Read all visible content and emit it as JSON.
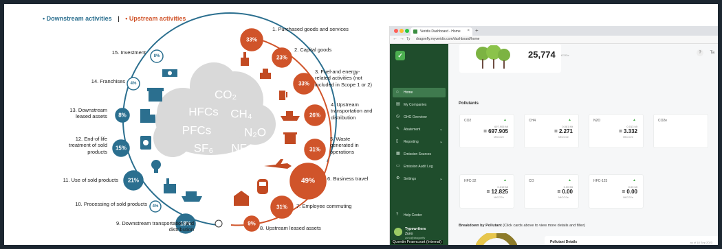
{
  "legend": {
    "downstream": "• Downstream activities",
    "separator": "|",
    "upstream": "• Upstream activities"
  },
  "colors": {
    "downstream": "#2b6f8f",
    "upstream": "#d0542a",
    "cloud": "#d9d9d9",
    "sidebar": "#1f4d2c",
    "accent_green": "#4caf50"
  },
  "cloud_gases": [
    "CO2",
    "HFCs",
    "CH4",
    "PFCs",
    "N2O",
    "SF6",
    "NF3"
  ],
  "categories": [
    {
      "label": "1. Purchased goods and services",
      "pct": "33%",
      "stream": "upstream"
    },
    {
      "label": "2. Capital goods",
      "pct": "23%",
      "stream": "upstream"
    },
    {
      "label": "3. Fuel-and energy-related activities (not included in Scope 1 or 2)",
      "pct": "33%",
      "stream": "upstream"
    },
    {
      "label": "4. Upstream transportation and distribution",
      "pct": "26%",
      "stream": "upstream"
    },
    {
      "label": "5. Waste generated in operations",
      "pct": "31%",
      "stream": "upstream"
    },
    {
      "label": "6. Business travel",
      "pct": "49%",
      "stream": "upstream"
    },
    {
      "label": "7. Employee commuting",
      "pct": "31%",
      "stream": "upstream"
    },
    {
      "label": "8. Upstream leased assets",
      "pct": "9%",
      "stream": "upstream"
    },
    {
      "label": "9. Downstream transportation and distribution",
      "pct": "18%",
      "stream": "downstream"
    },
    {
      "label": "10. Processing of sold products",
      "pct": "4%",
      "stream": "downstream"
    },
    {
      "label": "11. Use of sold products",
      "pct": "21%",
      "stream": "downstream"
    },
    {
      "label": "12. End-of life treatment of sold products",
      "pct": "15%",
      "stream": "downstream"
    },
    {
      "label": "13. Downstream leased assets",
      "pct": "8%",
      "stream": "downstream"
    },
    {
      "label": "14. Franchises",
      "pct": "4%",
      "stream": "downstream"
    },
    {
      "label": "15. Investment",
      "pct": "8%",
      "stream": "downstream"
    }
  ],
  "browser": {
    "tab_title": "Veridis Dashboard - Home",
    "url": "dragonfly.myveridis.com/dashboard/home"
  },
  "sidebar": {
    "items": [
      {
        "label": "Home",
        "icon": "home-icon",
        "glyph": "⌂",
        "active": true,
        "chevron": false
      },
      {
        "label": "My Companies",
        "icon": "building-icon",
        "glyph": "▤",
        "active": false,
        "chevron": false
      },
      {
        "label": "GHG Overview",
        "icon": "clock-icon",
        "glyph": "◷",
        "active": false,
        "chevron": false
      },
      {
        "label": "Abatement",
        "icon": "leaf-icon",
        "glyph": "✎",
        "active": false,
        "chevron": true
      },
      {
        "label": "Reporting",
        "icon": "document-icon",
        "glyph": "▯",
        "active": false,
        "chevron": true
      },
      {
        "label": "Emission Sources",
        "icon": "grid-icon",
        "glyph": "▦",
        "active": false,
        "chevron": false
      },
      {
        "label": "Emission Audit Log",
        "icon": "log-icon",
        "glyph": "▭",
        "active": false,
        "chevron": false
      },
      {
        "label": "Settings",
        "icon": "gear-icon",
        "glyph": "⚙",
        "active": false,
        "chevron": true
      }
    ],
    "help": "Help Center",
    "user_name": "Typewriters",
    "user_org": "Zuno",
    "user_email": "zuno@dragonfly",
    "caption": "Quentin Fraencourt (Internal)"
  },
  "main": {
    "help_glyph": "?",
    "user_initial": "Ta",
    "total_value": "25,774",
    "total_unit": "tCO2e",
    "pollutants_title": "Pollutants",
    "pollutants": [
      {
        "name": "CO2",
        "sub": "697.905 Mt",
        "value": "= 697.905",
        "unit": "MtCO2e"
      },
      {
        "name": "CH4",
        "sub": "0.081 Mt",
        "value": "= 2.271",
        "unit": "MtCO2e"
      },
      {
        "name": "N2O",
        "sub": "0.013 Mt",
        "value": "= 3.332",
        "unit": "MtCO2e"
      },
      {
        "name": "CO2e",
        "sub": "",
        "value": "",
        "unit": ""
      },
      {
        "name": "HFC-32",
        "sub": "0.019 Mt",
        "value": "= 12.825",
        "unit": "MtCO2e"
      },
      {
        "name": "CO",
        "sub": "0.00 Mt",
        "value": "= 0.00",
        "unit": "MtCO2e"
      },
      {
        "name": "HFC-125",
        "sub": "0.00 Mt",
        "value": "= 0.00",
        "unit": "MtCO2e"
      }
    ],
    "breakdown_title": "Breakdown by Pollutant",
    "breakdown_hint": "(Click cards above to view more details and filter)",
    "details_title": "Pollutant Details",
    "details_date": "as of 18 Sep 2023"
  }
}
